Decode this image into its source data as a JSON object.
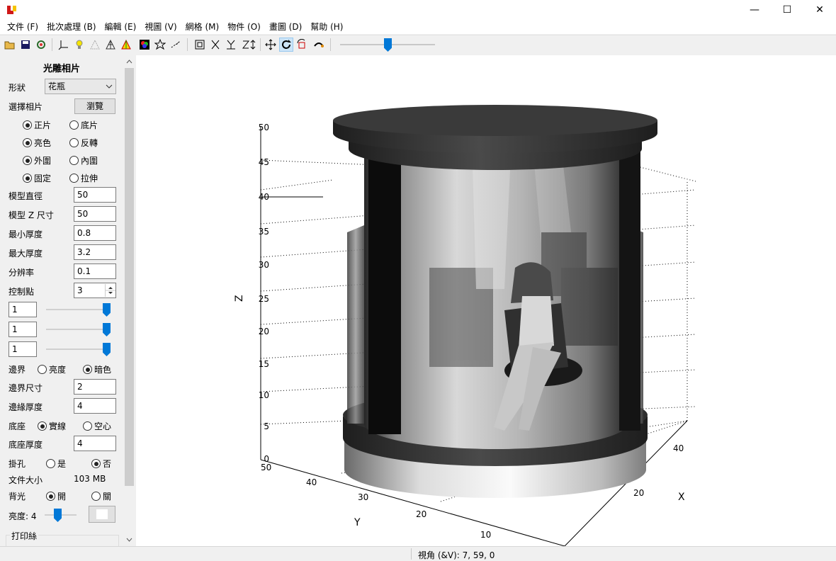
{
  "window": {
    "minimize": "—",
    "maximize": "☐",
    "close": "✕"
  },
  "menu": [
    "文件 (F)",
    "批次處理 (B)",
    "編輯 (E)",
    "視圖 (V)",
    "網格 (M)",
    "物件 (O)",
    "畫圖 (D)",
    "幫助 (H)"
  ],
  "toolbar_icons": [
    "open-folder-icon",
    "save-icon",
    "settings-icon",
    "axes-icon",
    "light-bulb-icon",
    "wireframe-icon",
    "mesh-icon",
    "color-mesh-icon",
    "colors-icon",
    "star-icon",
    "points-icon",
    "bounding-box-icon",
    "x-axis-icon",
    "y-axis-icon",
    "z-axis-icon",
    "move-icon",
    "rotate-icon",
    "cube-rotate-icon",
    "arc-icon"
  ],
  "panel": {
    "title": "光雕相片",
    "shape_label": "形狀",
    "shape_value": "花瓶",
    "select_photo_label": "選擇相片",
    "browse_button": "瀏覽",
    "positive": "正片",
    "negative": "底片",
    "bright": "亮色",
    "invert": "反轉",
    "outer": "外圍",
    "inner": "內圍",
    "fixed": "固定",
    "stretch": "拉伸",
    "model_diameter_label": "模型直徑",
    "model_diameter_value": "50",
    "model_z_label": "模型 Z 尺寸",
    "model_z_value": "50",
    "min_thickness_label": "最小厚度",
    "min_thickness_value": "0.8",
    "max_thickness_label": "最大厚度",
    "max_thickness_value": "3.2",
    "resolution_label": "分辨率",
    "resolution_value": "0.1",
    "control_points_label": "控制點",
    "control_points_value": "3",
    "cp_values": [
      "1",
      "1",
      "1"
    ],
    "border_label": "邊界",
    "border_bright": "亮度",
    "border_dark": "暗色",
    "border_size_label": "邊界尺寸",
    "border_size_value": "2",
    "edge_thickness_label": "邊緣厚度",
    "edge_thickness_value": "4",
    "base_label": "底座",
    "base_solid": "實線",
    "base_hollow": "空心",
    "base_thickness_label": "底座厚度",
    "base_thickness_value": "4",
    "hang_hole_label": "掛孔",
    "yes": "是",
    "no": "否",
    "file_size_label": "文件大小",
    "file_size_value": "103 MB",
    "backlight_label": "背光",
    "on": "開",
    "off": "關",
    "brightness_label": "亮度: 4",
    "print_group": "打印絲"
  },
  "plot": {
    "z_label": "Z",
    "x_label": "X",
    "y_label": "Y",
    "z_ticks": [
      "0",
      "5",
      "10",
      "15",
      "20",
      "25",
      "30",
      "35",
      "40",
      "45",
      "50"
    ],
    "y_ticks": [
      "50",
      "40",
      "30",
      "20",
      "10"
    ],
    "x_ticks": [
      "20",
      "40"
    ]
  },
  "status": {
    "view_angle": "視角 (&V): 7, 59, 0"
  }
}
